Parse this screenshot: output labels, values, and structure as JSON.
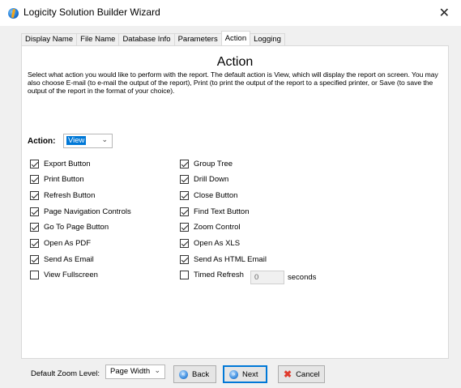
{
  "window": {
    "title": "Logicity Solution Builder Wizard",
    "close_glyph": "✕"
  },
  "tabs": [
    {
      "label": "Display Name",
      "active": false
    },
    {
      "label": "File Name",
      "active": false
    },
    {
      "label": "Database Info",
      "active": false
    },
    {
      "label": "Parameters",
      "active": false
    },
    {
      "label": "Action",
      "active": true
    },
    {
      "label": "Logging",
      "active": false
    }
  ],
  "panel": {
    "heading": "Action",
    "description": "Select what action you would like to perform with the report.  The default action is View, which will display the report on screen. You may also choose E-mail (to e-mail the output of the report), Print (to print the output of the report to a specified printer, or Save (to save the output of the report in the format of your choice).",
    "action_label": "Action:",
    "action_value": "View",
    "left_options": [
      {
        "label": "Export Button",
        "checked": true
      },
      {
        "label": "Print Button",
        "checked": true
      },
      {
        "label": "Refresh Button",
        "checked": true
      },
      {
        "label": "Page Navigation Controls",
        "checked": true
      },
      {
        "label": "Go To Page Button",
        "checked": true
      },
      {
        "label": "Open As PDF",
        "checked": true
      },
      {
        "label": "Send As Email",
        "checked": true
      },
      {
        "label": "View Fullscreen",
        "checked": false
      }
    ],
    "right_options": [
      {
        "label": "Group Tree",
        "checked": true
      },
      {
        "label": "Drill Down",
        "checked": true
      },
      {
        "label": "Close Button",
        "checked": true
      },
      {
        "label": "Find Text Button",
        "checked": true
      },
      {
        "label": "Zoom Control",
        "checked": true
      },
      {
        "label": "Open As XLS",
        "checked": true
      },
      {
        "label": "Send As HTML Email",
        "checked": true
      },
      {
        "label": "Timed Refresh",
        "checked": false
      }
    ],
    "timed_refresh_value": "0",
    "seconds_label": "seconds",
    "zoom_label": "Default Zoom Level:",
    "zoom_value": "Page Width"
  },
  "buttons": {
    "back": "Back",
    "next": "Next",
    "cancel": "Cancel"
  },
  "colors": {
    "accent": "#0078d7",
    "cancel_icon": "#e03a2c"
  }
}
